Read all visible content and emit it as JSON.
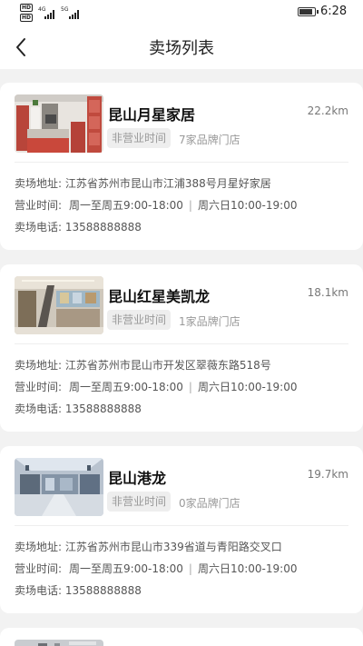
{
  "status_bar": {
    "hd_top": "HD",
    "hd_bottom": "HD",
    "network_1": "4G",
    "network_2": "5G",
    "time": "6:28"
  },
  "header": {
    "title": "卖场列表"
  },
  "labels": {
    "address": "卖场地址:",
    "hours": "营业时间:",
    "phone": "卖场电话:"
  },
  "stores": [
    {
      "name": "昆山月星家居",
      "distance": "22.2km",
      "status": "非营业时间",
      "brand_count": "7家品牌门店",
      "address": "江苏省苏州市昆山市江浦388号月星好家居",
      "hours_weekday": "周一至周五9:00-18:00",
      "hours_weekend": "周六日10:00-19:00",
      "phone": "13588888888"
    },
    {
      "name": "昆山红星美凯龙",
      "distance": "18.1km",
      "status": "非营业时间",
      "brand_count": "1家品牌门店",
      "address": "江苏省苏州市昆山市开发区翠薇东路518号",
      "hours_weekday": "周一至周五9:00-18:00",
      "hours_weekend": "周六日10:00-19:00",
      "phone": "13588888888"
    },
    {
      "name": "昆山港龙",
      "distance": "19.7km",
      "status": "非营业时间",
      "brand_count": "0家品牌门店",
      "address": "江苏省苏州市昆山市339省道与青阳路交叉口",
      "hours_weekday": "周一至周五9:00-18:00",
      "hours_weekend": "周六日10:00-19:00",
      "phone": "13588888888"
    }
  ],
  "colors": {
    "page_bg": "#f2f2f2",
    "card_bg": "#ffffff",
    "badge_bg": "#eeeeee",
    "muted_text": "#999999"
  }
}
